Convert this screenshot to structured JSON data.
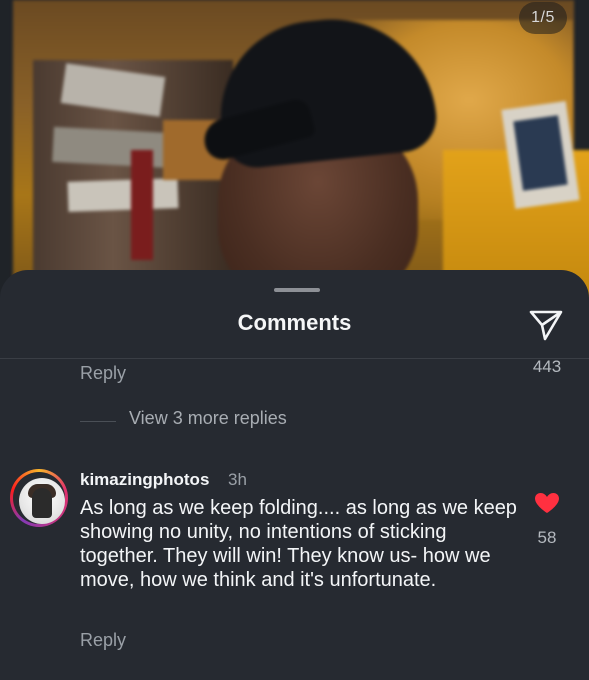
{
  "photo": {
    "page_indicator": "1/5"
  },
  "sheet": {
    "title": "Comments"
  },
  "previous_comment": {
    "reply_label": "Reply",
    "like_count": "443",
    "view_more_replies": "View 3 more replies"
  },
  "comment": {
    "username": "kimazingphotos",
    "time": "3h",
    "text": "As long as we keep folding.... as long as we keep showing no unity, no intentions of sticking together. They will win! They know us- how we move, how we think and it's unfortunate.",
    "like_count": "58",
    "reply_label": "Reply",
    "liked": true
  },
  "colors": {
    "sheet_background": "#262a31",
    "heart_red": "#ff3040",
    "secondary_text": "#9aa0a7"
  },
  "icons": {
    "send": "send-paper-plane-icon",
    "like": "heart-icon"
  }
}
